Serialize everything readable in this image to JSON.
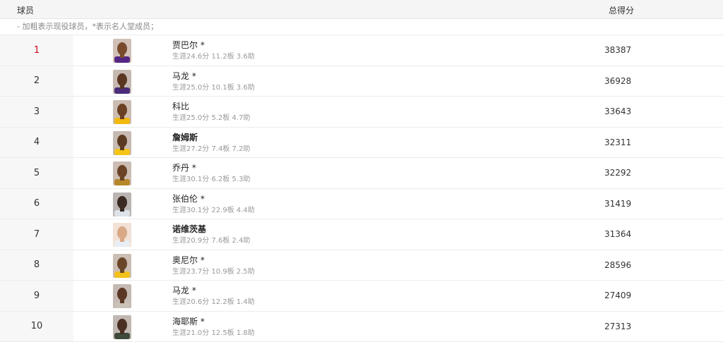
{
  "header": {
    "player_col": "球员",
    "points_col": "总得分"
  },
  "note": "- 加粗表示现役球员，*表示名人堂成员；",
  "players": [
    {
      "rank": "1",
      "name": "贾巴尔 *",
      "active": false,
      "stats": "生涯24.6分 11.2板 3.6助",
      "points": "38387",
      "jersey": "#552583",
      "skin": "#7a4a2c"
    },
    {
      "rank": "2",
      "name": "马龙 *",
      "active": false,
      "stats": "生涯25.0分 10.1板 3.6助",
      "points": "36928",
      "jersey": "#4b2c7a",
      "skin": "#5a3520"
    },
    {
      "rank": "3",
      "name": "科比",
      "active": false,
      "stats": "生涯25.0分 5.2板 4.7助",
      "points": "33643",
      "jersey": "#f2b90f",
      "skin": "#6b4023"
    },
    {
      "rank": "4",
      "name": "詹姆斯",
      "active": true,
      "stats": "生涯27.2分 7.4板 7.2助",
      "points": "32311",
      "jersey": "#f5c518",
      "skin": "#5c3a22"
    },
    {
      "rank": "5",
      "name": "乔丹 *",
      "active": false,
      "stats": "生涯30.1分 6.2板 5.3助",
      "points": "32292",
      "jersey": "#b8862b",
      "skin": "#6a4226"
    },
    {
      "rank": "6",
      "name": "张伯伦 *",
      "active": false,
      "stats": "生涯30.1分 22.9板 4.4助",
      "points": "31419",
      "jersey": "#dde3e8",
      "skin": "#3a2a22"
    },
    {
      "rank": "7",
      "name": "诺维茨基",
      "active": true,
      "stats": "生涯20.9分 7.6板 2.4助",
      "points": "31364",
      "jersey": "#e9eef5",
      "skin": "#d9a886"
    },
    {
      "rank": "8",
      "name": "奥尼尔 *",
      "active": false,
      "stats": "生涯23.7分 10.9板 2.5助",
      "points": "28596",
      "jersey": "#f2c21b",
      "skin": "#6a4628"
    },
    {
      "rank": "9",
      "name": "马龙 *",
      "active": false,
      "stats": "生涯20.6分 12.2板 1.4助",
      "points": "27409",
      "jersey": "#c9c2b7",
      "skin": "#5a3624"
    },
    {
      "rank": "10",
      "name": "海耶斯 *",
      "active": false,
      "stats": "生涯21.0分 12.5板 1.8助",
      "points": "27313",
      "jersey": "#3f4a3a",
      "skin": "#4a3022"
    }
  ]
}
